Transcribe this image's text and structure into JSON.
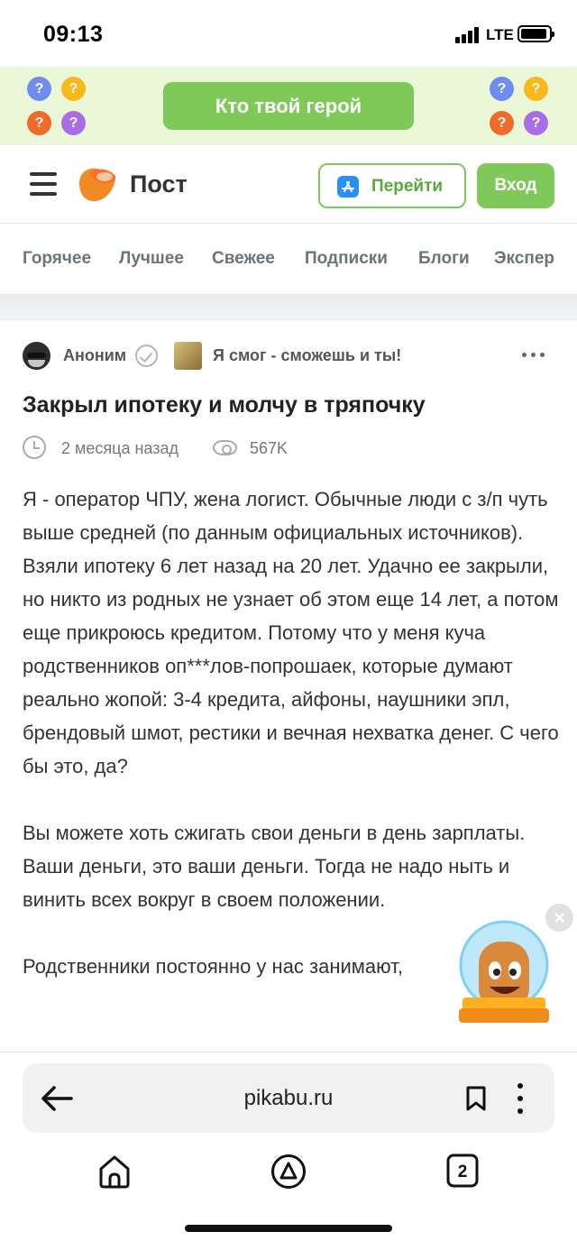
{
  "status_bar": {
    "time": "09:13",
    "network": "LTE"
  },
  "promo": {
    "button_label": "Кто твой герой",
    "question_mark": "?",
    "colors": [
      "#6f8cf1",
      "#f9b91d",
      "#f06a2c",
      "#a96de8"
    ]
  },
  "header": {
    "title": "Пост",
    "go_label": "Перейти",
    "login_label": "Вход"
  },
  "nav": {
    "items": [
      "Горячее",
      "Лучшее",
      "Свежее",
      "Подписки",
      "Блоги",
      "Экспер"
    ]
  },
  "post": {
    "author": "Аноним",
    "community": "Я смог - сможешь и ты!",
    "title": "Закрыл ипотеку и молчу в тряпочку",
    "time_ago": "2 месяца назад",
    "views": "567K",
    "paragraphs": [
      "Я - оператор ЧПУ, жена логист. Обычные люди с з/п чуть выше средней (по данным официальных источников). Взяли ипотеку 6 лет назад на 20 лет. Удачно ее закрыли, но никто из родных не узнает об этом еще 14 лет, а потом еще прикроюсь кредитом. Потому что у меня куча родственников оп***лов-попрошаек, которые думают реально жопой: 3-4 кредита, айфоны, наушники эпл, брендовый шмот, рестики и вечная нехватка денег. С чего бы это, да?",
      "Вы можете хоть сжигать свои деньги в день зарплаты. Ваши деньги, это ваши деньги. Тогда не надо ныть и винить всех вокруг в своем положении.",
      "Родственники постоянно у нас занимают,"
    ]
  },
  "browser": {
    "url": "pikabu.ru",
    "tab_count": "2"
  },
  "theme": {
    "accent_green": "#7fc95a",
    "banner_bg": "#eaf8d8"
  }
}
